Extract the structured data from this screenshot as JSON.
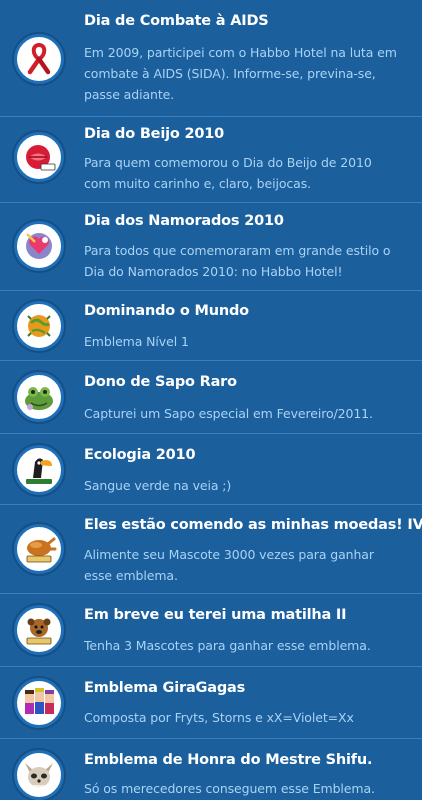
{
  "badges": [
    {
      "title": "Dia de Combate à AIDS",
      "description": "Em 2009, participei com o Habbo Hotel na luta em combate à AIDS (SIDA). Informe-se, previna-se, passe adiante.",
      "icon": "red-ribbon-icon"
    },
    {
      "title": "Dia do Beijo 2010",
      "description": "Para quem comemorou o Dia do Beijo de 2010 com muito carinho e, claro, beijocas.",
      "icon": "kiss-lips-icon"
    },
    {
      "title": "Dia dos Namorados 2010",
      "description": "Para todos que comemoraram em grande estilo o Dia do Namorados 2010: no Habbo Hotel!",
      "icon": "valentine-heart-icon"
    },
    {
      "title": "Dominando o Mundo",
      "description": "Emblema Nível 1",
      "icon": "world-globe-icon"
    },
    {
      "title": "Dono de Sapo Raro",
      "description": "Capturei um Sapo especial em Fevereiro/2011.",
      "icon": "frog-icon"
    },
    {
      "title": "Ecologia 2010",
      "description": "Sangue verde na veia ;)",
      "icon": "toucan-icon"
    },
    {
      "title": "Eles estão comendo as minhas moedas! IV",
      "description": "Alimente seu Mascote 3000 vezes para ganhar esse emblema.",
      "icon": "roast-chicken-icon"
    },
    {
      "title": "Em breve eu terei uma matilha II",
      "description": "Tenha 3 Mascotes para ganhar esse emblema.",
      "icon": "dog-pack-icon"
    },
    {
      "title": "Emblema GiraGagas",
      "description": "Composta por Fryts, Storns e xX=Violet=Xx",
      "icon": "group-avatars-icon"
    },
    {
      "title": "Emblema de Honra do Mestre Shifu.",
      "description": "Só os merecedores conseguem esse Emblema.",
      "icon": "master-shifu-icon"
    }
  ]
}
